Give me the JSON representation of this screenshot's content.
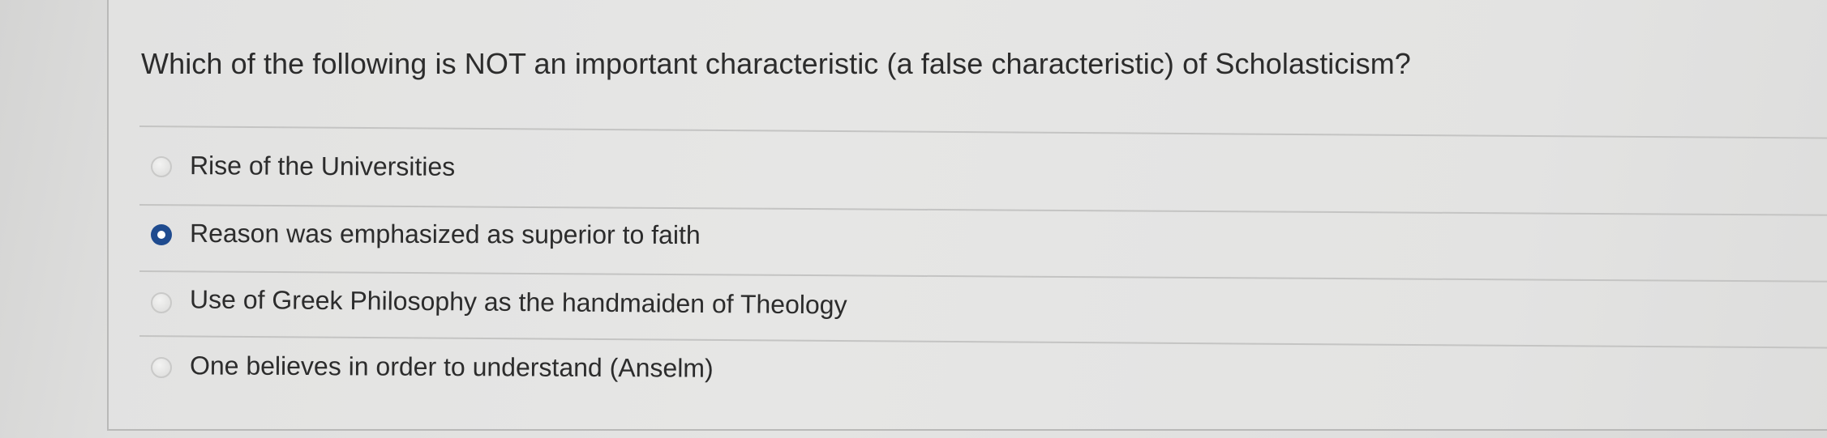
{
  "quiz": {
    "question": "Which of the following is NOT an important characteristic (a false characteristic) of Scholasticism?",
    "selected_index": 1,
    "options": [
      {
        "label": "Rise of the Universities",
        "selected": false
      },
      {
        "label": "Reason was emphasized as superior to faith",
        "selected": true
      },
      {
        "label": "Use of Greek Philosophy as the handmaiden of Theology",
        "selected": false
      },
      {
        "label": "One believes in order to understand (Anselm)",
        "selected": false
      }
    ]
  },
  "colors": {
    "selected_radio": "#1f4b8f",
    "text": "#2c2c2c",
    "background": "#e3e3e2"
  }
}
